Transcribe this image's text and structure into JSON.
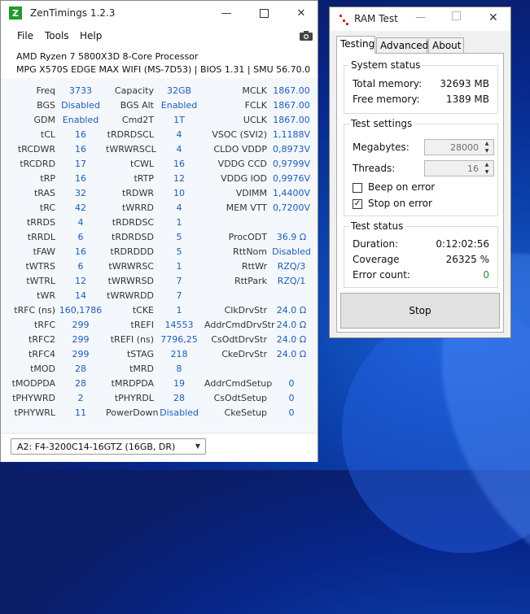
{
  "zt": {
    "title": "ZenTimings 1.2.3",
    "app_icon_letter": "Z",
    "menu": [
      "File",
      "Tools",
      "Help"
    ],
    "cpu": "AMD Ryzen 7 5800X3D 8-Core Processor",
    "board": "MPG X570S EDGE MAX WIFI (MS-7D53) | BIOS 1.31 | SMU 56.70.0",
    "rows": [
      [
        [
          "Freq",
          "3733"
        ],
        [
          "Capacity",
          "32GB"
        ],
        [
          "MCLK",
          "1867.00"
        ]
      ],
      [
        [
          "BGS",
          "Disabled"
        ],
        [
          "BGS Alt",
          "Enabled"
        ],
        [
          "FCLK",
          "1867.00"
        ]
      ],
      [
        [
          "GDM",
          "Enabled"
        ],
        [
          "Cmd2T",
          "1T"
        ],
        [
          "UCLK",
          "1867.00"
        ]
      ],
      [
        [
          "tCL",
          "16"
        ],
        [
          "tRDRDSCL",
          "4"
        ],
        [
          "VSOC (SVI2)",
          "1,1188V"
        ]
      ],
      [
        [
          "tRCDWR",
          "16"
        ],
        [
          "tWRWRSCL",
          "4"
        ],
        [
          "CLDO VDDP",
          "0,8973V"
        ]
      ],
      [
        [
          "tRCDRD",
          "17"
        ],
        [
          "tCWL",
          "16"
        ],
        [
          "VDDG CCD",
          "0,9799V"
        ]
      ],
      [
        [
          "tRP",
          "16"
        ],
        [
          "tRTP",
          "12"
        ],
        [
          "VDDG IOD",
          "0,9976V"
        ]
      ],
      [
        [
          "tRAS",
          "32"
        ],
        [
          "tRDWR",
          "10"
        ],
        [
          "VDIMM",
          "1,4400V"
        ]
      ],
      [
        [
          "tRC",
          "42"
        ],
        [
          "tWRRD",
          "4"
        ],
        [
          "MEM VTT",
          "0,7200V"
        ]
      ],
      [
        [
          "tRRDS",
          "4"
        ],
        [
          "tRDRDSC",
          "1"
        ],
        [
          "",
          ""
        ]
      ],
      [
        [
          "tRRDL",
          "6"
        ],
        [
          "tRDRDSD",
          "5"
        ],
        [
          "ProcODT",
          "36.9 Ω"
        ]
      ],
      [
        [
          "tFAW",
          "16"
        ],
        [
          "tRDRDDD",
          "5"
        ],
        [
          "RttNom",
          "Disabled"
        ]
      ],
      [
        [
          "tWTRS",
          "6"
        ],
        [
          "tWRWRSC",
          "1"
        ],
        [
          "RttWr",
          "RZQ/3"
        ]
      ],
      [
        [
          "tWTRL",
          "12"
        ],
        [
          "tWRWRSD",
          "7"
        ],
        [
          "RttPark",
          "RZQ/1"
        ]
      ],
      [
        [
          "tWR",
          "14"
        ],
        [
          "tWRWRDD",
          "7"
        ],
        [
          "",
          ""
        ]
      ],
      [
        [
          "tRFC (ns)",
          "160,1786"
        ],
        [
          "tCKE",
          "1"
        ],
        [
          "ClkDrvStr",
          "24.0 Ω"
        ]
      ],
      [
        [
          "tRFC",
          "299"
        ],
        [
          "tREFI",
          "14553"
        ],
        [
          "AddrCmdDrvStr",
          "24.0 Ω"
        ]
      ],
      [
        [
          "tRFC2",
          "299"
        ],
        [
          "tREFI (ns)",
          "7796,25"
        ],
        [
          "CsOdtDrvStr",
          "24.0 Ω"
        ]
      ],
      [
        [
          "tRFC4",
          "299"
        ],
        [
          "tSTAG",
          "218"
        ],
        [
          "CkeDrvStr",
          "24.0 Ω"
        ]
      ],
      [
        [
          "tMOD",
          "28"
        ],
        [
          "tMRD",
          "8"
        ],
        [
          "",
          ""
        ]
      ],
      [
        [
          "tMODPDA",
          "28"
        ],
        [
          "tMRDPDA",
          "19"
        ],
        [
          "AddrCmdSetup",
          "0"
        ]
      ],
      [
        [
          "tPHYWRD",
          "2"
        ],
        [
          "tPHYRDL",
          "28"
        ],
        [
          "CsOdtSetup",
          "0"
        ]
      ],
      [
        [
          "tPHYWRL",
          "11"
        ],
        [
          "PowerDown",
          "Disabled"
        ],
        [
          "CkeSetup",
          "0"
        ]
      ]
    ],
    "dimm_select": "A2: F4-3200C14-16GTZ (16GB, DR)"
  },
  "rt": {
    "title": "RAM Test",
    "tabs": [
      "Testing",
      "Advanced",
      "About"
    ],
    "system_status": {
      "title": "System status",
      "total_label": "Total memory:",
      "total_value": "32693 MB",
      "free_label": "Free memory:",
      "free_value": "1389 MB"
    },
    "settings": {
      "title": "Test settings",
      "megabytes_label": "Megabytes:",
      "megabytes_value": "28000",
      "threads_label": "Threads:",
      "threads_value": "16",
      "beep_label": "Beep on error",
      "beep_checked": false,
      "stop_label": "Stop on error",
      "stop_checked": true
    },
    "status": {
      "title": "Test status",
      "duration_label": "Duration:",
      "duration_value": "0:12:02:56",
      "coverage_label": "Coverage",
      "coverage_value": "26325 %",
      "errors_label": "Error count:",
      "errors_value": "0"
    },
    "stop_button": "Stop"
  },
  "colors": {
    "value_blue": "#1d5fb4",
    "body_bg": "#f4f7fc",
    "error_green": "#2e8b2e"
  }
}
